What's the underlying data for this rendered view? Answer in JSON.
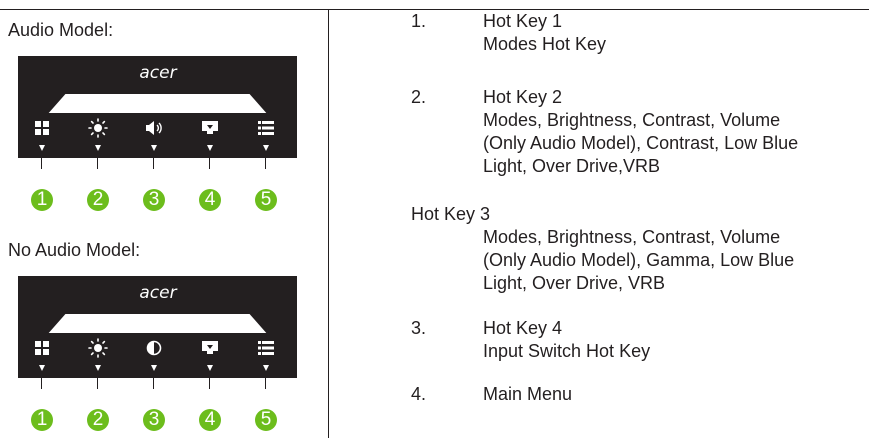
{
  "left": {
    "audio_title": "Audio Model:",
    "no_audio_title": "No Audio Model:",
    "logo_text": "acer",
    "audio_keys": [
      "grid-icon",
      "brightness-icon",
      "speaker-icon",
      "input-icon",
      "menu-icon"
    ],
    "no_audio_keys": [
      "grid-icon",
      "brightness-icon",
      "contrast-icon",
      "input-icon",
      "menu-icon"
    ],
    "numbers": [
      "1",
      "2",
      "3",
      "4",
      "5"
    ],
    "accent_color": "#6cbd1c",
    "panel_color": "#231f20"
  },
  "right": {
    "item1": {
      "num": "1.",
      "title": "Hot Key 1",
      "desc": "Modes Hot Key"
    },
    "item2": {
      "num": "2.",
      "title": "Hot Key 2",
      "lines": [
        "Modes, Brightness, Contrast, Volume",
        "(Only Audio Model), Contrast, Low Blue",
        "Light, Over Drive,VRB"
      ]
    },
    "item_hk3": {
      "title": "Hot Key 3",
      "lines": [
        "Modes, Brightness, Contrast, Volume",
        "(Only Audio Model), Gamma, Low Blue",
        "Light, Over Drive, VRB"
      ]
    },
    "item3": {
      "num": "3.",
      "title": "Hot Key 4",
      "desc": "Input Switch Hot Key"
    },
    "item4": {
      "num": "4.",
      "title": "Main Menu"
    }
  }
}
